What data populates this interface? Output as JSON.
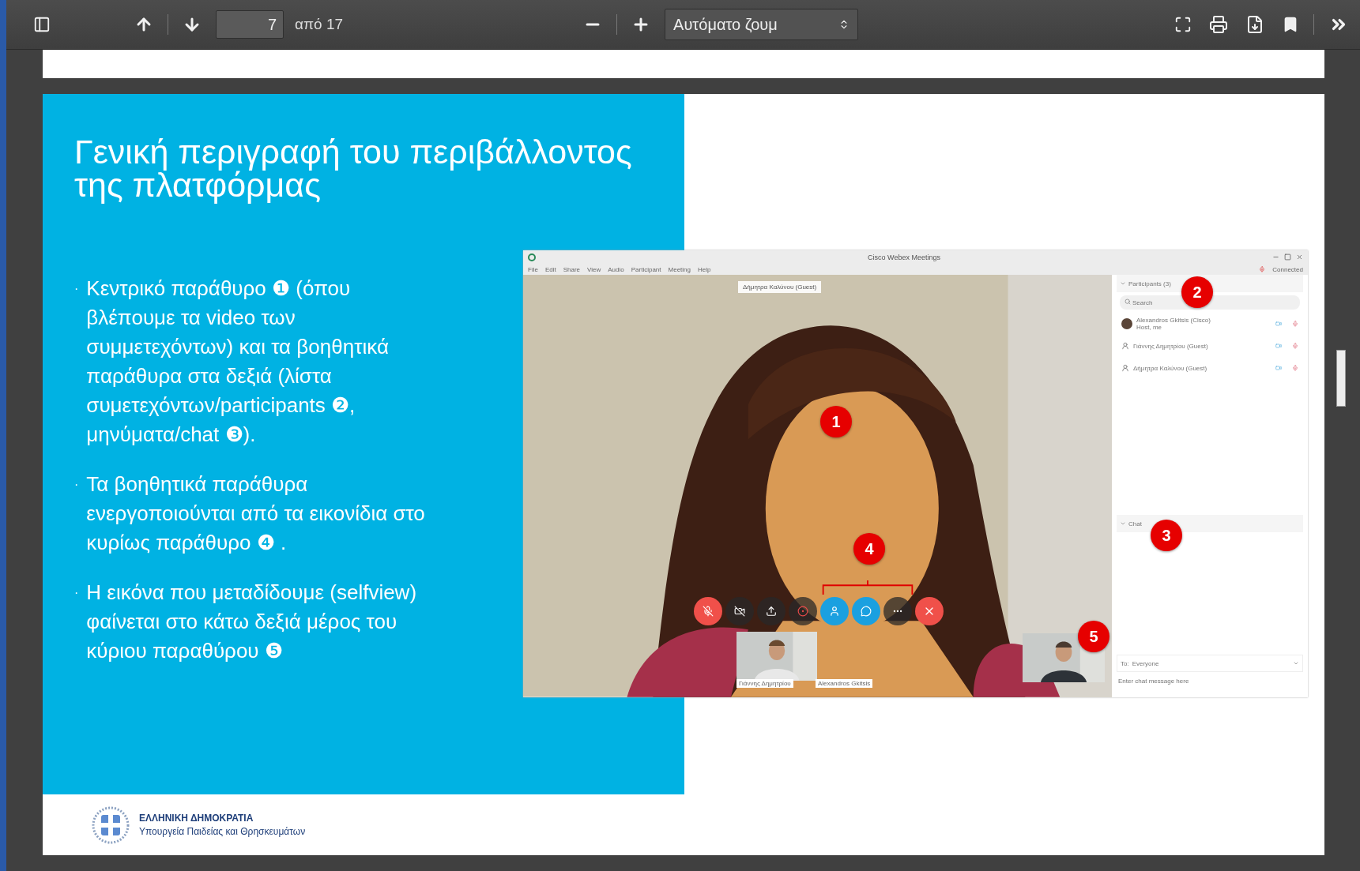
{
  "toolbar": {
    "page": "7",
    "page_count": "από 17",
    "zoom": "Αυτόματο ζουμ"
  },
  "slide": {
    "title": "Γενική περιγραφή του περιβάλλοντος της πλατφόρμας",
    "bullets": [
      {
        "marker": "·",
        "text": "Κεντρικό παράθυρο ❶ (όπου βλέπουμε τα video των συμμετεχόντων) και τα βοηθητικά παράθυρα στα δεξιά (λίστα συμετεχόντων/participants ❷, μηνύματα/chat ❸)."
      },
      {
        "marker": "·",
        "text": "Τα βοηθητικά παράθυρα ενεργοποιούνται από τα εικονίδια στο κυρίως παράθυρο ❹ ."
      },
      {
        "marker": "·",
        "text": "Η εικόνα που μεταδίδουμε (selfview) φαίνεται στο κάτω δεξιά μέρος του κύριου παραθύρου ❺"
      }
    ],
    "footer": {
      "country": "ΕΛΛΗΝΙΚΗ ΔΗΜΟΚΡΑΤΙΑ",
      "ministry": "Υπουργεία Παιδείας και Θρησκευμάτων"
    }
  },
  "webex": {
    "title": "Cisco Webex Meetings",
    "menu": [
      "File",
      "Edit",
      "Share",
      "View",
      "Audio",
      "Participant",
      "Meeting",
      "Help"
    ],
    "status": "Connected",
    "speaker_label": "Δήμητρα Καλύνου (Guest)",
    "controls": [
      {
        "kind": "mute",
        "selected": false
      },
      {
        "kind": "video",
        "selected": false
      },
      {
        "kind": "share",
        "selected": false
      },
      {
        "kind": "record",
        "selected": false
      },
      {
        "kind": "participants",
        "selected": true
      },
      {
        "kind": "chat",
        "selected": true
      },
      {
        "kind": "more",
        "selected": false
      },
      {
        "kind": "leave",
        "selected": false
      }
    ],
    "thumbnail_labels": [
      "Γιάννης Δημητρίου",
      "Alexandros Gkitsis"
    ],
    "participants": {
      "header": "Participants (3)",
      "search_placeholder": "Search",
      "rows": [
        {
          "name": "Alexandros Gkitsis (Cisco)",
          "role": "Host, me"
        },
        {
          "name": "Γιάννης Δημητρίου (Guest)",
          "kind": "guest"
        },
        {
          "name": "Δήμητρα Καλύνου (Guest)",
          "kind": "guest"
        }
      ]
    },
    "chat": {
      "header": "Chat",
      "to_label": "To:",
      "recipient": "Everyone",
      "placeholder": "Enter chat message here"
    },
    "callouts": [
      "1",
      "2",
      "3",
      "4",
      "5"
    ]
  }
}
